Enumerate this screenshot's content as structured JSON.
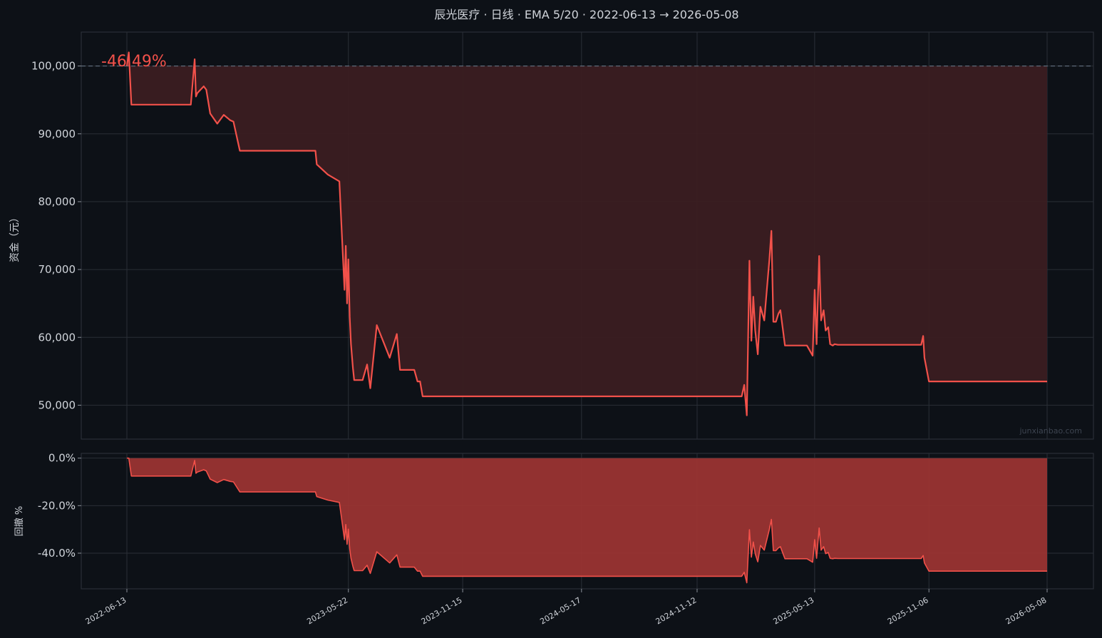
{
  "title": "辰光医疗 · 日线 · EMA 5/20 · 2022-06-13 → 2026-05-08",
  "watermark": "junxianbao.com",
  "colors": {
    "background": "#0d1117",
    "line": "#f2514a",
    "equity_fill": "#3b1e21",
    "drawdown_fill": "#9a3432",
    "grid": "#2a2f37",
    "text": "#d0d4da",
    "baseline": "#6b7b8a"
  },
  "chart_data": [
    {
      "type": "line",
      "name": "equity",
      "return_label": "-46.49%",
      "ylabel": "资金（元）",
      "yticks": [
        100000,
        90000,
        80000,
        70000,
        60000,
        50000
      ],
      "ytick_labels": [
        "100,000",
        "90,000",
        "80,000",
        "70,000",
        "60,000",
        "50,000"
      ],
      "ylim": [
        45000,
        105000
      ],
      "baseline": 100000,
      "grid": true,
      "x": [
        "2022-06-13",
        "2022-06-16",
        "2022-06-20",
        "2022-07-05",
        "2022-08-10",
        "2022-09-20",
        "2022-09-26",
        "2022-09-28",
        "2022-09-30",
        "2022-10-10",
        "2022-10-14",
        "2022-10-20",
        "2022-10-31",
        "2022-11-10",
        "2022-11-20",
        "2022-11-25",
        "2022-12-05",
        "2022-12-10",
        "2022-12-20",
        "2023-01-03",
        "2023-02-15",
        "2023-03-10",
        "2023-04-01",
        "2023-04-03",
        "2023-04-20",
        "2023-05-08",
        "2023-05-16",
        "2023-05-18",
        "2023-05-20",
        "2023-05-22",
        "2023-05-24",
        "2023-05-26",
        "2023-05-29",
        "2023-05-31",
        "2023-06-02",
        "2023-06-06",
        "2023-06-08",
        "2023-06-13",
        "2023-06-20",
        "2023-06-25",
        "2023-07-05",
        "2023-07-25",
        "2023-08-05",
        "2023-08-10",
        "2023-08-16",
        "2023-08-22",
        "2023-08-25",
        "2023-08-29",
        "2023-09-01",
        "2023-09-06",
        "2023-09-10",
        "2023-09-14",
        "2023-09-18",
        "2023-10-20",
        "2023-11-01",
        "2023-11-03",
        "2023-11-08",
        "2023-11-13",
        "2023-11-20",
        "2024-01-01",
        "2024-06-01",
        "2024-11-01",
        "2025-01-20",
        "2025-01-24",
        "2025-01-28",
        "2025-02-01",
        "2025-02-04",
        "2025-02-07",
        "2025-02-10",
        "2025-02-14",
        "2025-02-18",
        "2025-02-24",
        "2025-02-28",
        "2025-03-04",
        "2025-03-07",
        "2025-03-10",
        "2025-03-14",
        "2025-03-18",
        "2025-03-21",
        "2025-03-25",
        "2025-03-28",
        "2025-04-01",
        "2025-04-07",
        "2025-04-15",
        "2025-05-01",
        "2025-05-10",
        "2025-05-13",
        "2025-05-16",
        "2025-05-20",
        "2025-05-23",
        "2025-05-27",
        "2025-05-30",
        "2025-06-03",
        "2025-06-06",
        "2025-06-10",
        "2025-06-13",
        "2025-06-18",
        "2025-06-20",
        "2025-06-25",
        "2025-07-01",
        "2025-09-01",
        "2025-10-25",
        "2025-10-28",
        "2025-10-30",
        "2025-11-06",
        "2026-01-01",
        "2026-05-08"
      ],
      "y": [
        100000,
        102000,
        94300,
        94300,
        94300,
        94300,
        101000,
        95500,
        96000,
        97000,
        96500,
        93000,
        91500,
        92800,
        92000,
        91800,
        87500,
        87500,
        87500,
        87500,
        87500,
        87500,
        87500,
        85500,
        84000,
        83000,
        67000,
        73500,
        65000,
        71500,
        63000,
        59000,
        55500,
        53700,
        53700,
        53700,
        53700,
        53700,
        56000,
        52500,
        61800,
        57000,
        60500,
        55200,
        55200,
        55200,
        55200,
        55200,
        55200,
        53500,
        53500,
        51300,
        51300,
        51300,
        51300,
        51300,
        51300,
        51300,
        51300,
        51300,
        51300,
        51300,
        51300,
        53000,
        48500,
        71300,
        59500,
        66000,
        61000,
        57500,
        64500,
        62500,
        67000,
        71500,
        75700,
        62300,
        62300,
        63500,
        64000,
        61000,
        58800,
        58800,
        58800,
        58800,
        58800,
        57300,
        67000,
        59000,
        72000,
        62500,
        64000,
        61000,
        61500,
        59000,
        58800,
        59000,
        58900,
        58900,
        58900,
        58900,
        58900,
        58900,
        60200,
        57000,
        53500,
        53500,
        53500
      ]
    },
    {
      "type": "area",
      "name": "drawdown",
      "ylabel": "回撤 %",
      "yticks": [
        0,
        -20,
        -40
      ],
      "ytick_labels": [
        "0.0%",
        "-20.0%",
        "-40.0%"
      ],
      "ylim": [
        -55,
        2
      ],
      "grid": true
    }
  ],
  "x_axis": {
    "ticks": [
      "2022-06-13",
      "2023-05-22",
      "2023-11-15",
      "2024-05-17",
      "2024-11-12",
      "2025-05-13",
      "2025-11-06",
      "2026-05-08"
    ]
  }
}
